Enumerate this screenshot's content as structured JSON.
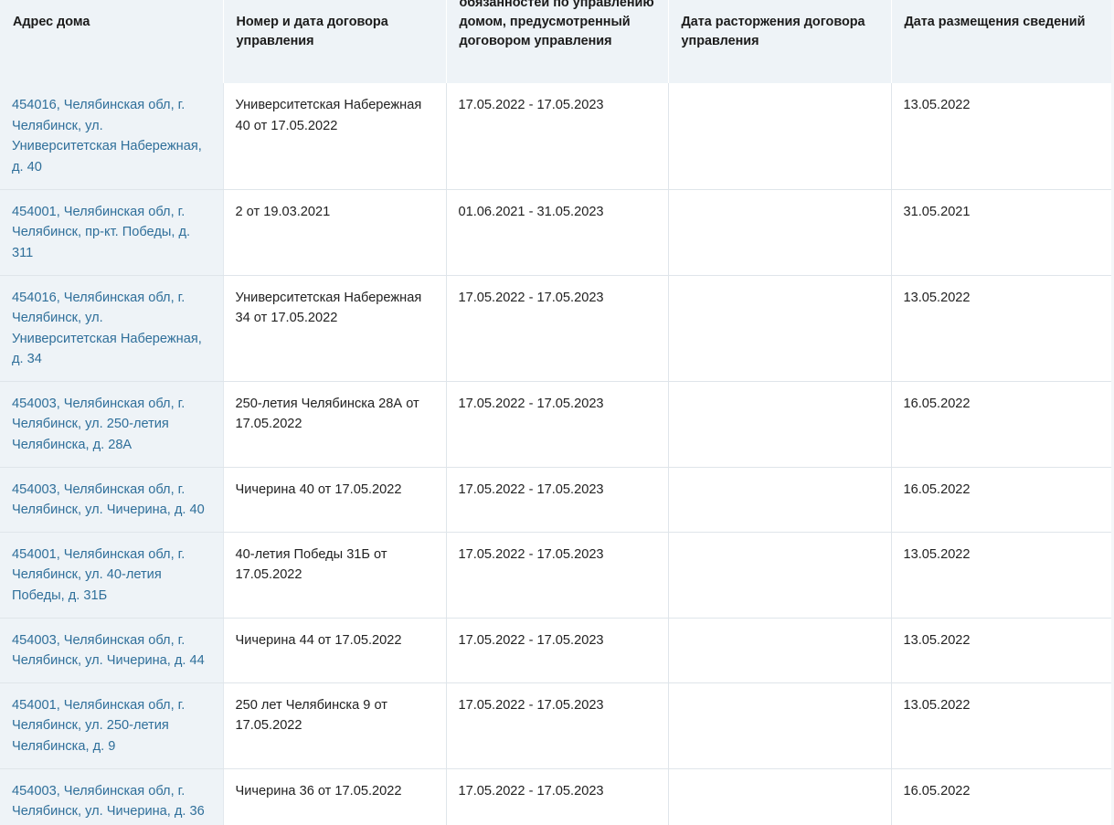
{
  "table": {
    "headers": {
      "address": "Адрес дома",
      "contract_number_date": "Номер и дата договора управления",
      "obligations_period": "обязанностей по управлению домом, предусмотренный договором управления",
      "termination_date": "Дата расторжения договора управления",
      "publication_date": "Дата размещения сведений"
    },
    "rows": [
      {
        "address": "454016, Челябинская обл, г. Челябинск, ул. Университетская Набережная, д. 40",
        "contract": "Университетская Набережная 40 от 17.05.2022",
        "period": "17.05.2022 - 17.05.2023",
        "termination": "",
        "published": "13.05.2022"
      },
      {
        "address": "454001, Челябинская обл, г. Челябинск, пр-кт. Победы, д. 311",
        "contract": "2 от 19.03.2021",
        "period": "01.06.2021 - 31.05.2023",
        "termination": "",
        "published": "31.05.2021"
      },
      {
        "address": "454016, Челябинская обл, г. Челябинск, ул. Университетская Набережная, д. 34",
        "contract": "Университетская Набережная 34 от 17.05.2022",
        "period": "17.05.2022 - 17.05.2023",
        "termination": "",
        "published": "13.05.2022"
      },
      {
        "address": "454003, Челябинская обл, г. Челябинск, ул. 250-летия Челябинска, д. 28А",
        "contract": "250-летия Челябинска 28А от 17.05.2022",
        "period": "17.05.2022 - 17.05.2023",
        "termination": "",
        "published": "16.05.2022"
      },
      {
        "address": "454003, Челябинская обл, г. Челябинск, ул. Чичерина, д. 40",
        "contract": "Чичерина 40 от 17.05.2022",
        "period": "17.05.2022 - 17.05.2023",
        "termination": "",
        "published": "16.05.2022"
      },
      {
        "address": "454001, Челябинская обл, г. Челябинск, ул. 40-летия Победы, д. 31Б",
        "contract": "40-летия Победы 31Б от 17.05.2022",
        "period": "17.05.2022 - 17.05.2023",
        "termination": "",
        "published": "13.05.2022"
      },
      {
        "address": "454003, Челябинская обл, г. Челябинск, ул. Чичерина, д. 44",
        "contract": "Чичерина 44 от 17.05.2022",
        "period": "17.05.2022 - 17.05.2023",
        "termination": "",
        "published": "13.05.2022"
      },
      {
        "address": "454001, Челябинская обл, г. Челябинск, ул. 250-летия Челябинска, д. 9",
        "contract": "250 лет Челябинска 9 от 17.05.2022",
        "period": "17.05.2022 - 17.05.2023",
        "termination": "",
        "published": "13.05.2022"
      },
      {
        "address": "454003, Челябинская обл, г. Челябинск, ул. Чичерина, д. 36",
        "contract": "Чичерина 36 от 17.05.2022",
        "period": "17.05.2022 - 17.05.2023",
        "termination": "",
        "published": "16.05.2022"
      }
    ]
  },
  "colors": {
    "header_bg": "#eef3f7",
    "address_link": "#2f6f9a",
    "border": "#dfe5ea"
  }
}
